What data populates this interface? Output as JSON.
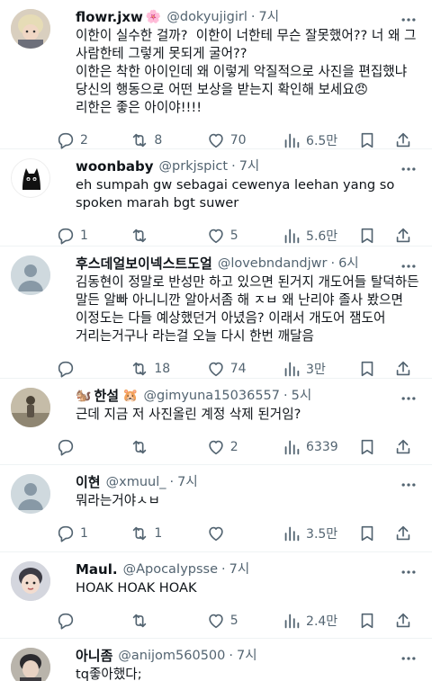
{
  "tweets": [
    {
      "name": "flowr.jxw",
      "badge": "🌸",
      "handle": "@dokyujigirl",
      "time": "7시",
      "body": "이한이 실수한 걸까?  이한이 너한테 무슨 잘못했어?? 너 왜 그 사람한테 그렇게 못되게 굴어??\n이한은 착한 아이인데 왜 이렇게 악질적으로 사진을 편집했냐\n당신의 행동으로 어떤 보상을 받는지 확인해 보세요😠\n리한은 좋은 아이야!!!!",
      "replies": "2",
      "retweets": "8",
      "likes": "70",
      "views": "6.5만"
    },
    {
      "name": "woonbaby",
      "badge": "",
      "handle": "@prkjspict",
      "time": "7시",
      "body": "eh sumpah gw sebagai cewenya leehan yang so spoken marah bgt suwer",
      "replies": "1",
      "retweets": "",
      "likes": "5",
      "views": "5.6만"
    },
    {
      "name": "후스데얼보이넥스트도얼",
      "badge": "",
      "handle": "@lovebndandjwr",
      "time": "6시",
      "body": "김동현이 정말로 반성만 하고 있으면 된거지 개도어들 탈덕하든 말든 알빠 아니니깐 알아서좀 해 ㅈㅂ 왜 난리야 졸사 봤으면 이정도는 다들 예상했던거 아녔음? 이래서 개도어 잼도어 거리는거구나 라는걸 오늘 다시 한번 깨달음",
      "replies": "",
      "retweets": "18",
      "likes": "74",
      "views": "3만"
    },
    {
      "name": "한설",
      "badge": "🐹",
      "prefix": "🐿️",
      "handle": "@gimyuna15036557",
      "time": "5시",
      "body": "근데 지금 저 사진올린 계정 삭제 된거임?",
      "replies": "",
      "retweets": "",
      "likes": "2",
      "views": "6339"
    },
    {
      "name": "이현",
      "badge": "",
      "handle": "@xmuul_",
      "time": "7시",
      "body": "뭐라는거야ㅅㅂ",
      "replies": "1",
      "retweets": "1",
      "likes": "",
      "views": "3.5만"
    },
    {
      "name": "Maul.",
      "badge": "",
      "handle": "@ApocaIypsse",
      "time": "7시",
      "body": "HOAK HOAK HOAK",
      "replies": "",
      "retweets": "",
      "likes": "5",
      "views": "2.4만"
    },
    {
      "name": "아니좀",
      "badge": "",
      "handle": "@anijom560500",
      "time": "7시",
      "body": "tq좋아했다;",
      "replies": "",
      "retweets": "",
      "likes": "",
      "views": ""
    }
  ],
  "colors": {
    "text": "#0f1419",
    "muted": "#536471",
    "divider": "#eff3f4",
    "background": "#ffffff"
  }
}
